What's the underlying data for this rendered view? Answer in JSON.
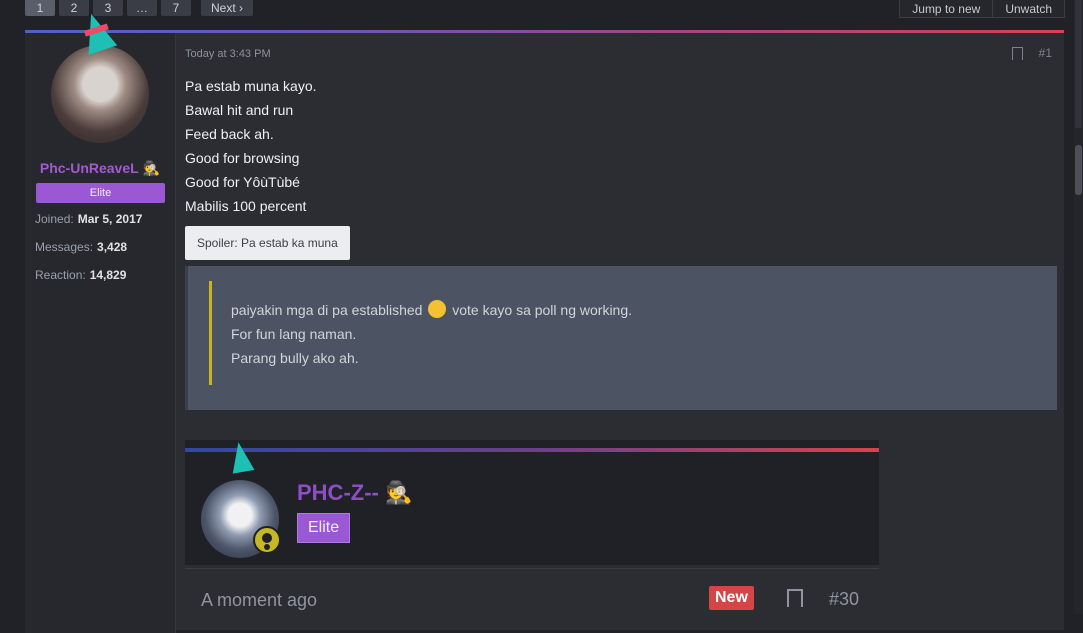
{
  "pager": {
    "pages": [
      "1",
      "2",
      "3",
      "…",
      "7"
    ],
    "next_label": "Next ›"
  },
  "thread_actions": {
    "jump_label": "Jump to new",
    "unwatch_label": "Unwatch"
  },
  "post": {
    "timestamp": "Today at 3:43 PM",
    "number": "#1",
    "author": {
      "name": "Phc-UnReaveL",
      "rank": "Elite",
      "joined_label": "Joined:",
      "joined": "Mar 5, 2017",
      "messages_label": "Messages:",
      "messages": "3,428",
      "reaction_label": "Reaction:",
      "reaction": "14,829"
    },
    "lines": [
      "Pa estab muna kayo.",
      "Bawal hit and run",
      "Feed back ah.",
      "Good for browsing",
      "Good for YôùTùbé",
      "Mabilis 100 percent"
    ],
    "spoiler_label": "Spoiler: Pa estab ka muna",
    "quote": {
      "line1_before": "paiyakin mga di pa established",
      "line1_after": "vote kayo sa poll ng working.",
      "line2": "For fun lang naman.",
      "line3": "Parang bully ako ah."
    }
  },
  "embedded_post": {
    "name": "PHC-Z--",
    "rank": "Elite",
    "time": "A moment ago",
    "badge": "New",
    "number": "#30"
  },
  "colors": {
    "accent_purple": "#9b58d4",
    "username_purple": "#a35ad1",
    "new_badge": "#d44545",
    "quote_border": "#c9b31f"
  }
}
